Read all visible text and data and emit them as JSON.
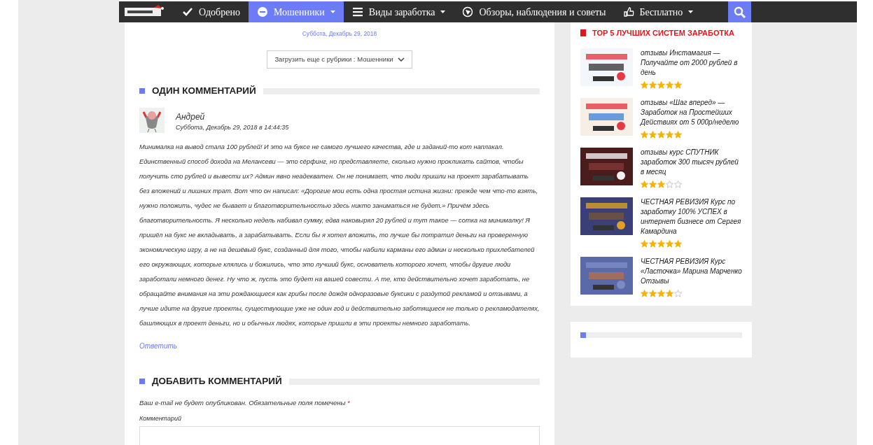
{
  "navbar": {
    "items": [
      {
        "label": "Одобрено",
        "kind": "check",
        "dropdown": false,
        "selected": false
      },
      {
        "label": "Мошенники",
        "kind": "stop",
        "dropdown": true,
        "selected": true
      },
      {
        "label": "Виды заработка",
        "kind": "list",
        "dropdown": true,
        "selected": false
      },
      {
        "label": "Обзоры, наблюдения и советы",
        "kind": "reviews",
        "dropdown": false,
        "selected": false
      },
      {
        "label": "Бесплатно",
        "kind": "free",
        "dropdown": true,
        "selected": false
      }
    ]
  },
  "post_date": "Суббота, Декабрь 29, 2018",
  "load_more": {
    "label": "Загрузить еще с рубрики : Мошенники"
  },
  "comments_section": {
    "title": "ОДИН КОММЕНТАРИЙ",
    "comments": [
      {
        "author": "Андрей",
        "date": "Суббота, Декабрь 29, 2018 в 14:44:35",
        "text": "Минималка на вывод стала 100 рублей! И это на буксе не самого лучшего качества, где и заданий-то кот наплакал. Единственный способ дохода на Мелансеви — это сёрфинг, но представляете, сколько нужно прокликать сайтов, чтобы получить сто рублей и вывести их? Админ явно неадекватен. Он не понимает, что люди пришли на проект зарабатывать без вложений и лишних трат. Вот что он написал: «Дорогие мои есть одна простая истина жизни: прежде чем что-то взять, нужно положить, чудес не бывает и благотворительностью здесь никто заниматься не будет.» Причём здесь благотворительность. Я несколько недель набивал сумму, едва наковырял 20 рублей и тут такое — сотка на минималку! Я пришёл на букс не вкладывать, а зарабатывать. Если бы я хотел вложить, то лучше бы потратил деньги на проверенную экономическую игру, а не на дешёвый букс, созданный для того, чтобы набили карманы его админ и несколько прихлебателей его окружающих, которые клялись и божились, что это лучший букс, основатель которого хочет, чтобы другие люди заработали немного денег. Ну что ж, пусть это будет на вашей совести. А те, кто действительно хочет заработать, не обращайте внимания на эти рождающиеся как грибы после дождя одноразовые буксики с раздутой рекламой и отзывами, а лучше идите на другие проекты, существующие уже не один год и действительно заботящиеся не только о рекламодателях, башляющих в проект деньги, но и обычных людях, которые пришли в эти проекты немного заработать.",
        "reply": "Ответить"
      }
    ]
  },
  "comment_form": {
    "title": "ДОБАВИТЬ КОММЕНТАРИЙ",
    "note": "Ваш e-mail не будет опубликован. Обязательные поля помечены",
    "required_mark": "*",
    "field_label": "Комментарий"
  },
  "sidebar": {
    "title": "TOP 5 ЛУЧШИХ СИСТЕМ ЗАРАБОТКА",
    "items": [
      {
        "title": "отзывы Инстамагия — Получайте от 2000 рублей в день",
        "stars": 5
      },
      {
        "title": "отзывы «Шаг вперед» — Заработок на Простейших Действиях от 5 000р/неделю",
        "stars": 5
      },
      {
        "title": "отзывы курс СПУТНИК заработок 300 тысяч рублей в месяц",
        "stars": 3
      },
      {
        "title": "ЧЕСТНАЯ РЕВИЗИЯ Курс по заработку 100% УСПЕХ в интернет бизнесе от Сергея Камардина",
        "stars": 5
      },
      {
        "title": "ЧЕСТНАЯ РЕВИЗИЯ Курс «Ласточка» Марина Марченко Отзывы",
        "stars": 4
      }
    ]
  }
}
